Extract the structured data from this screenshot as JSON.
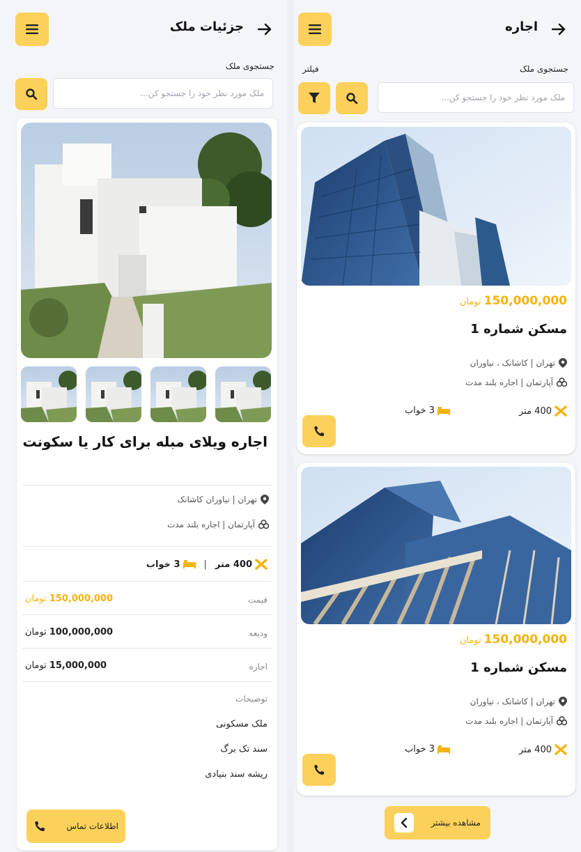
{
  "listing": {
    "header": {
      "title": "اجاره"
    },
    "search": {
      "label": "جستجوی ملک",
      "placeholder": "ملک مورد نظر خود را جستجو کن..."
    },
    "filter": {
      "label": "فیلتر"
    },
    "cards": [
      {
        "price": "150,000,000",
        "unit": "تومان",
        "title": "مسکن شماره 1",
        "location": "تهران | کاشانک ، نیاوران",
        "type": "آپارتمان | اجاره بلند مدت",
        "area": "400 متر",
        "beds": "3 خواب"
      },
      {
        "price": "150,000,000",
        "unit": "تومان",
        "title": "مسکن شماره 1",
        "location": "تهران | کاشانک ، نیاوران",
        "type": "آپارتمان | اجاره بلند مدت",
        "area": "400 متر",
        "beds": "3 خواب"
      }
    ],
    "more_label": "مشاهده بیشتر"
  },
  "details": {
    "header": {
      "title": "جزئیات ملک"
    },
    "search": {
      "label": "جستجوی ملک",
      "placeholder": "ملک مورد نظر خود را جستجو کن..."
    },
    "title": "اجاره ویلای مبله برای کار یا سکونت",
    "location": "تهران | نیاوران کاشانک",
    "type": "آپارتمان | اجاره بلند مدت",
    "area": "400 متر",
    "beds": "3 خواب",
    "feature_separator": "|",
    "rows": [
      {
        "label": "قیمت",
        "value": "150,000,000",
        "unit": "تومان"
      },
      {
        "label": "ودیعه",
        "value": "100,000,000",
        "unit": "تومان"
      },
      {
        "label": "اجاره",
        "value": "15,000,000",
        "unit": "تومان"
      }
    ],
    "description_label": "توضیحات",
    "description_items": [
      "ملک مسکونی",
      "سند تک برگ",
      "ریشه سند بنیادی"
    ],
    "contact_label": "اطلاعات تماس"
  },
  "colors": {
    "accent": "#fcd15b",
    "price": "#f5b30c",
    "background": "#eef0f4"
  },
  "icons": [
    "menu-icon",
    "back-arrow-icon",
    "search-icon",
    "filter-icon",
    "location-pin-icon",
    "building-icon",
    "area-icon",
    "bed-icon",
    "phone-icon",
    "chevron-left-icon"
  ]
}
